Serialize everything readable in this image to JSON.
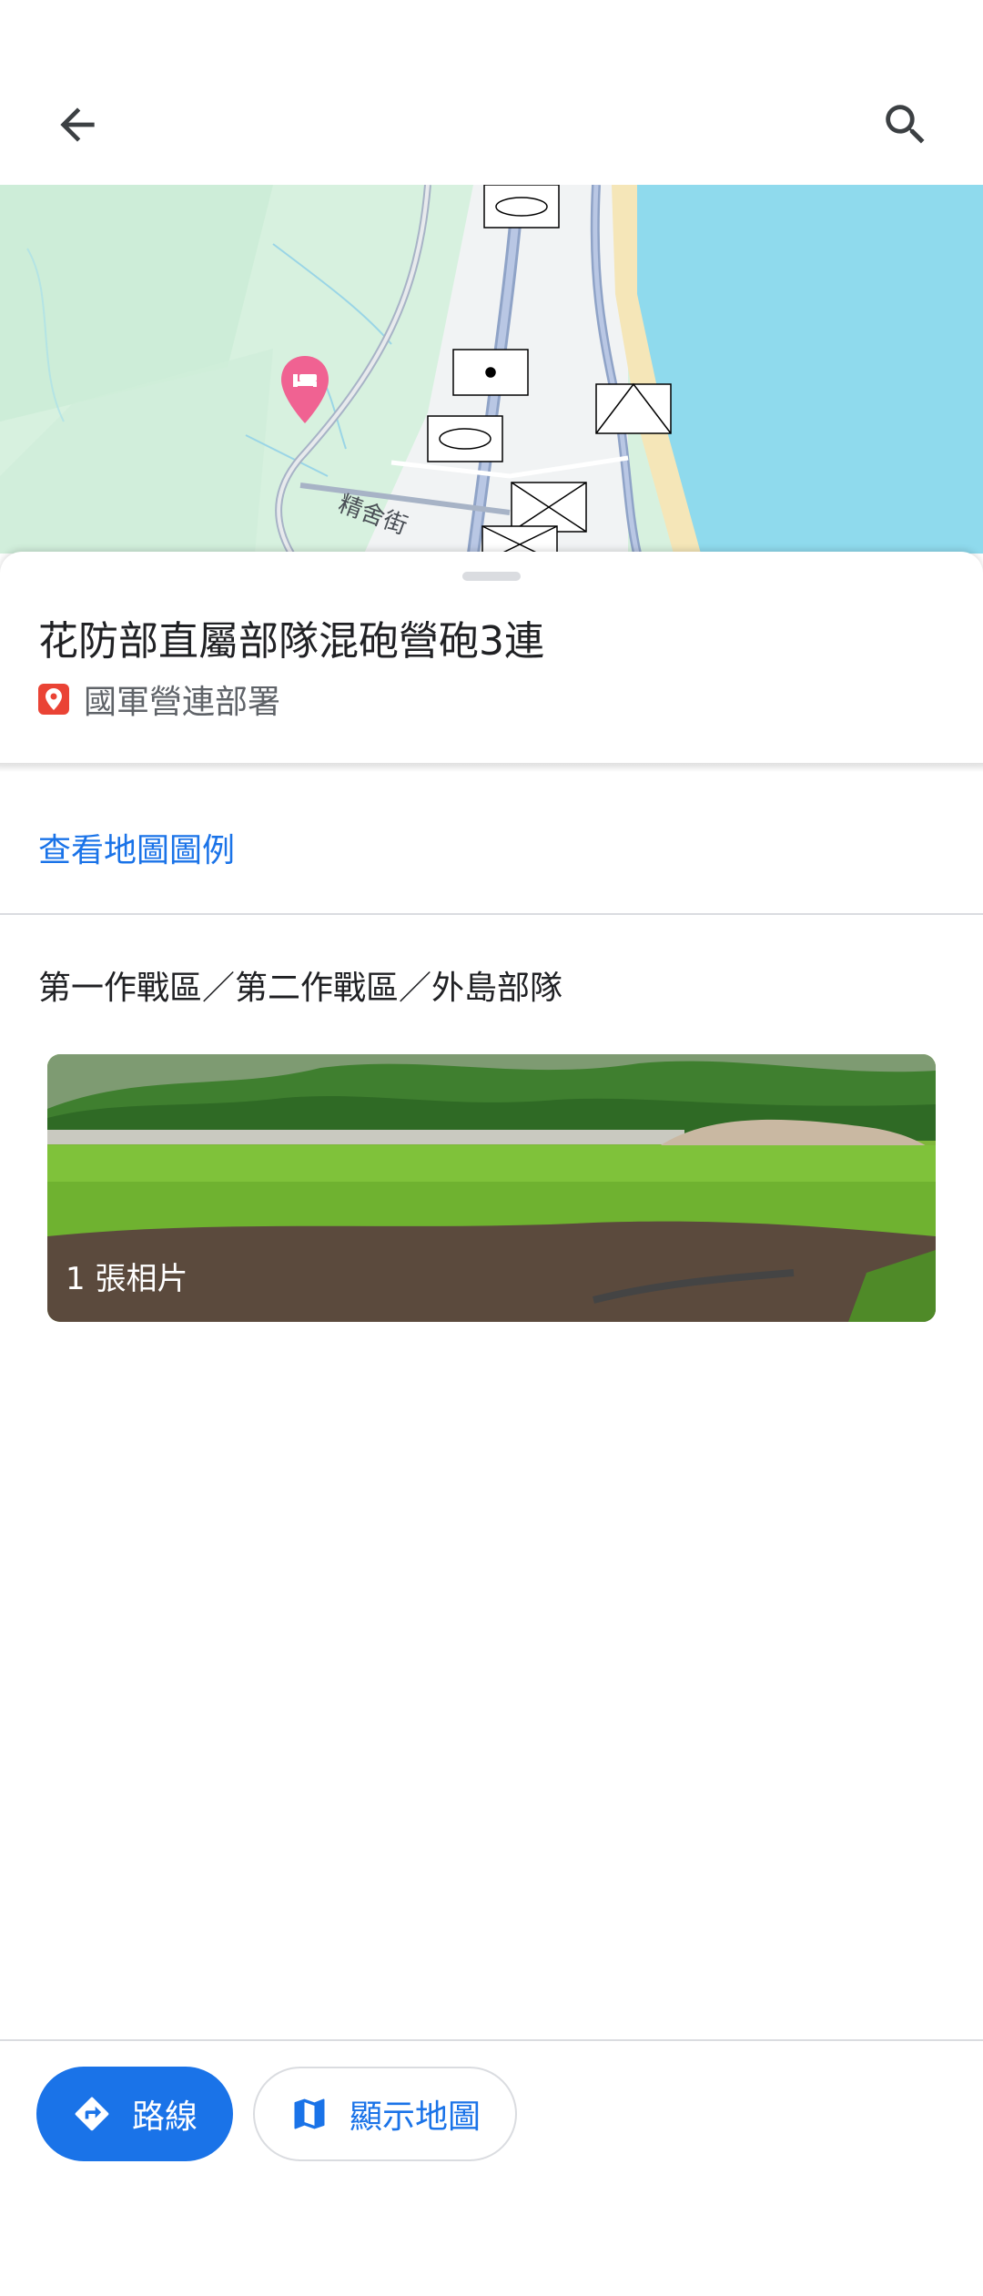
{
  "topbar": {
    "back_icon": "arrow-back-icon",
    "search_icon": "search-icon"
  },
  "map": {
    "street_label": "精舍街",
    "hotel_marker_icon": "hotel-marker-icon",
    "colors": {
      "land": "#d7f1df",
      "road": "#f1f3f4",
      "water": "#8fdaed",
      "beach": "#f5e6b8",
      "marker": "#f06292"
    }
  },
  "place": {
    "title": "花防部直屬部隊混砲營砲3連",
    "category_icon": "location-pin-icon",
    "category": "國軍營連部署"
  },
  "legend": {
    "link": "查看地圖圖例"
  },
  "area": {
    "text": "第一作戰區／第二作戰區／外島部隊"
  },
  "photo": {
    "caption": "1 張相片"
  },
  "actions": {
    "route_label": "路線",
    "route_icon": "directions-icon",
    "map_label": "顯示地圖",
    "map_icon": "map-icon"
  },
  "colors": {
    "accent": "#1a73e8",
    "pin": "#ea4335"
  }
}
